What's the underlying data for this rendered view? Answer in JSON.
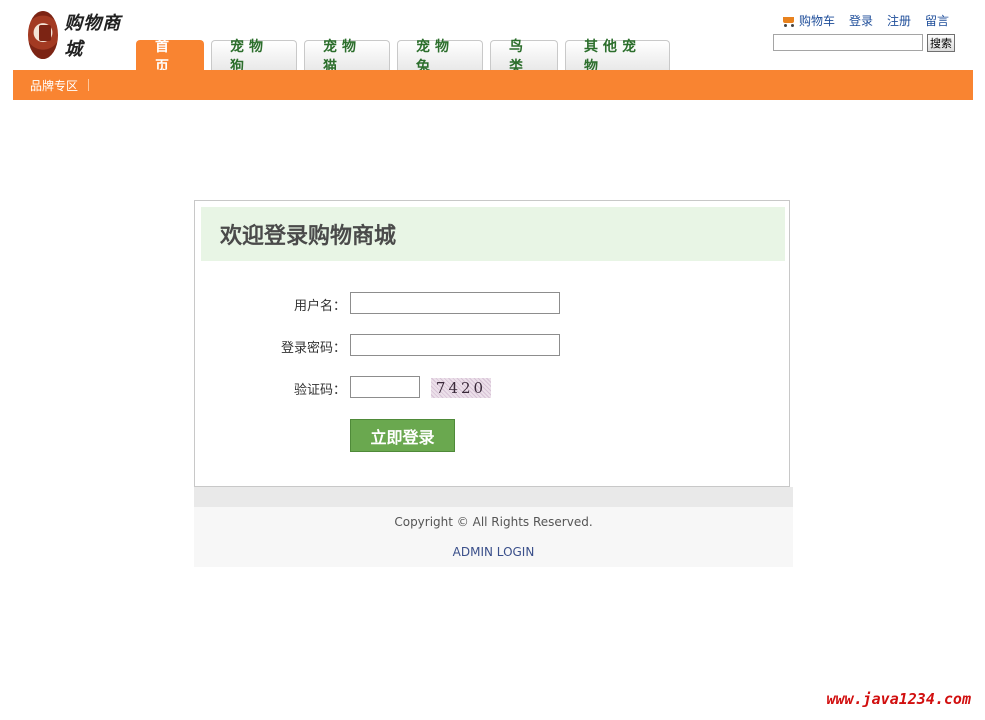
{
  "header": {
    "logo_text": "购物商城",
    "tabs": [
      {
        "label": "首页"
      },
      {
        "label": "宠物狗"
      },
      {
        "label": "宠物猫"
      },
      {
        "label": "宠物兔"
      },
      {
        "label": "鸟类"
      },
      {
        "label": "其他宠物"
      }
    ],
    "links": {
      "cart": "购物车",
      "login": "登录",
      "register": "注册",
      "message": "留言"
    },
    "search": {
      "value": "",
      "button_label": "搜索"
    },
    "subnav": {
      "brand_zone": "品牌专区"
    }
  },
  "login": {
    "title": "欢迎登录购物商城",
    "username_label": "用户名：",
    "password_label": "登录密码：",
    "captcha_label": "验证码：",
    "username_value": "",
    "password_value": "",
    "captcha_value": "",
    "captcha_image_text": "7420",
    "submit_label": "立即登录"
  },
  "footer": {
    "copyright": "Copyright © All Rights Reserved.",
    "admin_link": "ADMIN LOGIN"
  },
  "watermark": "www.java1234.com",
  "colors": {
    "accent": "#f98431",
    "login_button": "#6aa84f",
    "title_bar": "#e8f5e5"
  }
}
